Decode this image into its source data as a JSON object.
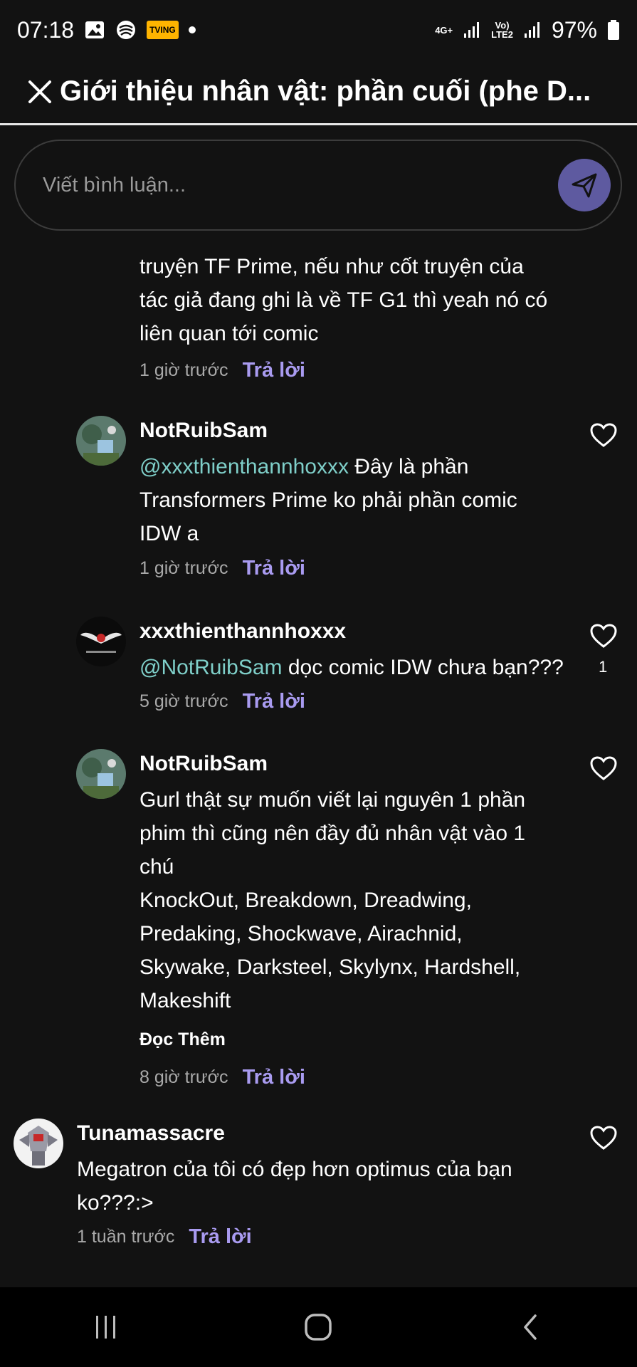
{
  "status_bar": {
    "time": "07:18",
    "tving_label": "TVING",
    "network_1": "4G+",
    "network_2_top": "Vo)",
    "network_2_bottom": "LTE2",
    "battery": "97%"
  },
  "header": {
    "title": "Giới thiệu nhân vật: phần cuối (phe D..."
  },
  "comment_input": {
    "placeholder": "Viết bình luận..."
  },
  "comments": [
    {
      "text": "truyện TF Prime, nếu như cốt truyện của tác giả đang ghi là về TF G1 thì yeah nó có liên quan tới comic",
      "time": "1 giờ trước",
      "reply_label": "Trả lời"
    },
    {
      "author": "NotRuibSam",
      "mention": "@xxxthienthannhoxxx",
      "text": " Đây là phần Transformers Prime ko phải phần comic IDW a",
      "time": "1 giờ trước",
      "reply_label": "Trả lời"
    },
    {
      "author": "xxxthienthannhoxxx",
      "mention": "@NotRuibSam",
      "text": " dọc comic IDW chưa bạn???",
      "time": "5 giờ trước",
      "reply_label": "Trả lời",
      "likes": "1"
    },
    {
      "author": "NotRuibSam",
      "text_lines": [
        "Gurl thật sự muốn viết lại nguyên 1 phần phim thì cũng nên đầy đủ nhân vật vào 1 chú",
        "KnockOut, Breakdown, Dreadwing, Predaking, Shockwave, Airachnid, Skywake, Darksteel, Skylynx, Hardshell, Makeshift"
      ],
      "more_label": "Đọc Thêm",
      "time": "8 giờ trước",
      "reply_label": "Trả lời"
    },
    {
      "author": "Tunamassacre",
      "text": "Megatron của tôi có đẹp hơn optimus của bạn ko???:>",
      "time": "1 tuần trước",
      "reply_label": "Trả lời"
    }
  ],
  "colors": {
    "background": "#121212",
    "accent": "#a99bf0",
    "mention": "#7fcfc9",
    "send_button": "#5e5aa0"
  }
}
